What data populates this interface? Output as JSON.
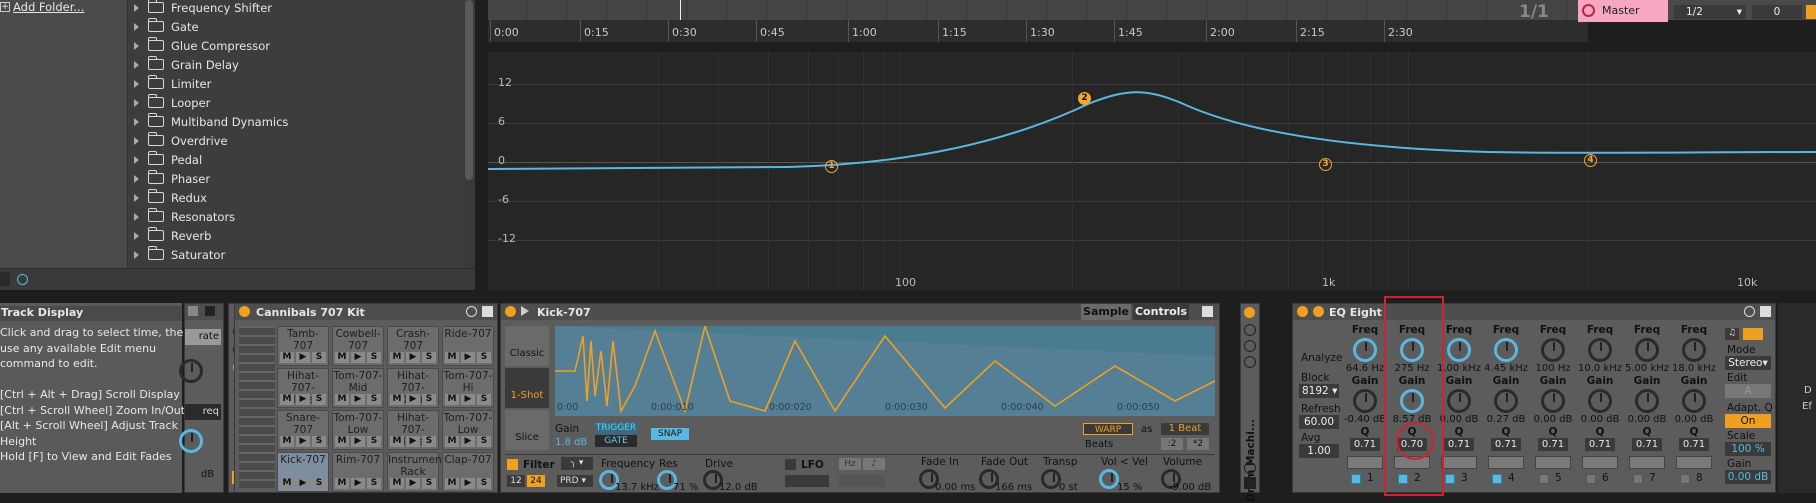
{
  "browser": {
    "add_folder": "Add Folder...",
    "items": [
      "Frequency Shifter",
      "Gate",
      "Glue Compressor",
      "Grain Delay",
      "Limiter",
      "Looper",
      "Multiband Dynamics",
      "Overdrive",
      "Pedal",
      "Phaser",
      "Redux",
      "Resonators",
      "Reverb",
      "Saturator"
    ]
  },
  "arrangement": {
    "position": "1/1",
    "master_label": "Master",
    "quantize": "1/2",
    "offset": "0",
    "timeline": [
      "0:00",
      "0:15",
      "0:30",
      "0:45",
      "1:00",
      "1:15",
      "1:30",
      "1:45",
      "2:00",
      "2:15",
      "2:30"
    ]
  },
  "eq_display": {
    "y_labels": [
      "12",
      "6",
      "0",
      "-6",
      "-12"
    ],
    "x_labels": [
      "100",
      "1k",
      "10k"
    ],
    "band_markers": [
      "1",
      "2",
      "3",
      "4"
    ],
    "colors": {
      "curve": "#5ab8e0",
      "marker": "#f0a830"
    }
  },
  "info_view": {
    "title": "Track Display",
    "lines": [
      "Click and drag to select time, then",
      "use any available Edit menu",
      "command to edit.",
      "",
      "[Ctrl + Alt + Drag] Scroll Display",
      "[Ctrl + Scroll Wheel] Zoom In/Out",
      "[Alt + Scroll Wheel] Adjust Track",
      "Height",
      "Hold [F] to View and Edit Fades"
    ]
  },
  "partial_device": {
    "label_rate": "rate",
    "label_req": "req",
    "value_db": "dB"
  },
  "drum_rack": {
    "title": "Cannibals 707 Kit",
    "pads": [
      [
        "Tamb-707",
        "Cowbell-707",
        "Crash-707",
        "Ride-707"
      ],
      [
        "Hihat-707-Closed",
        "Tom-707-Mid",
        "Hihat-707-Open",
        "Tom-707-Hi"
      ],
      [
        "Snare-707",
        "Tom-707-Low",
        "Hihat-707-Closed",
        "Tom-707-Low"
      ],
      [
        "Kick-707",
        "Rim-707",
        "Instrument Rack",
        "Clap-707"
      ]
    ],
    "mute": "M",
    "solo": "S"
  },
  "simpler": {
    "title": "Kick-707",
    "tab_sample": "Sample",
    "tab_controls": "Controls",
    "modes": [
      "Classic",
      "1-Shot",
      "Slice"
    ],
    "wave_times": [
      "0:00",
      "0:00:010",
      "0:00:020",
      "0:00:030",
      "0:00:040",
      "0:00:050"
    ],
    "gain_label": "Gain",
    "gain_value": "1.8 dB",
    "trigger": "TRIGGER",
    "gate": "GATE",
    "snap": "SNAP",
    "warp": "WARP",
    "as": "as",
    "beat": "1 Beat",
    "beats": "Beats",
    "div2": ":2",
    "mul2": "*2",
    "filter_label": "Filter",
    "filter_12": "12",
    "filter_24": "24",
    "filter_type": "PRD",
    "frequency_label": "Frequency",
    "frequency_value": "13.7 kHz",
    "res_label": "Res",
    "res_value": "71 %",
    "drive_label": "Drive",
    "drive_value": "12.0 dB",
    "lfo_label": "LFO",
    "lfo_hz": "Hz",
    "fadein_label": "Fade In",
    "fadein_value": "0.00 ms",
    "fadeout_label": "Fade Out",
    "fadeout_value": "166 ms",
    "transp_label": "Transp",
    "transp_value": "0 st",
    "vol_vel_label": "Vol < Vel",
    "vol_vel_value": "15 %",
    "volume_label": "Volume",
    "volume_value": "-9.00 dB"
  },
  "drum_machine_label": "Drum Machi...",
  "eq_eight": {
    "title": "EQ Eight",
    "analyze": "Analyze",
    "block_label": "Block",
    "block_value": "8192",
    "refresh_label": "Refresh",
    "refresh_value": "60.00",
    "avg_label": "Avg",
    "avg_value": "1.00",
    "freq_label": "Freq",
    "gain_label": "Gain",
    "q_label": "Q",
    "bands": [
      {
        "freq": "64.6 Hz",
        "gain": "-0.40 dB",
        "q": "0.71",
        "num": "1",
        "on": true
      },
      {
        "freq": "275 Hz",
        "gain": "8.57 dB",
        "q": "0.70",
        "num": "2",
        "on": true
      },
      {
        "freq": "1.00 kHz",
        "gain": "0.00 dB",
        "q": "0.71",
        "num": "3",
        "on": true
      },
      {
        "freq": "4.45 kHz",
        "gain": "0.27 dB",
        "q": "0.71",
        "num": "4",
        "on": true
      },
      {
        "freq": "100 Hz",
        "gain": "0.00 dB",
        "q": "0.71",
        "num": "5",
        "on": false
      },
      {
        "freq": "10.0 kHz",
        "gain": "0.00 dB",
        "q": "0.71",
        "num": "6",
        "on": false
      },
      {
        "freq": "5.00 kHz",
        "gain": "0.00 dB",
        "q": "0.71",
        "num": "7",
        "on": false
      },
      {
        "freq": "18.0 kHz",
        "gain": "0.00 dB",
        "q": "0.71",
        "num": "8",
        "on": false
      }
    ],
    "mode_label": "Mode",
    "mode_value": "Stereo",
    "edit_label": "Edit",
    "edit_value": "A",
    "adapt_q_label": "Adapt. Q",
    "adapt_q_value": "On",
    "scale_label": "Scale",
    "scale_value": "100 %",
    "gain_out_label": "Gain",
    "gain_out_value": "0.00 dB",
    "right_edge_d": "D",
    "right_edge_ef": "Ef"
  }
}
